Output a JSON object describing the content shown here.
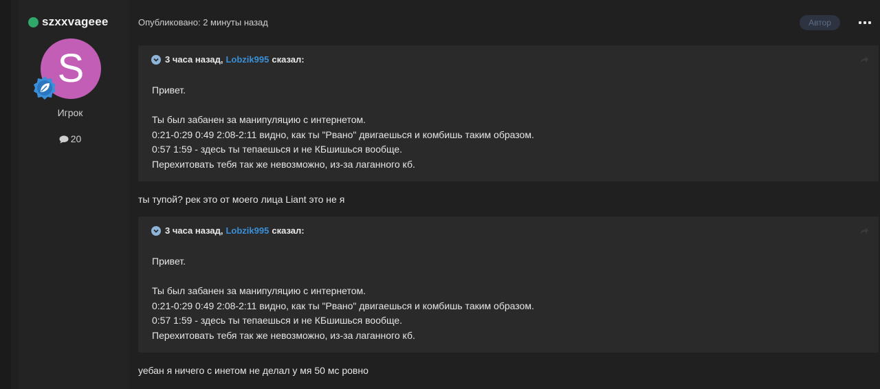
{
  "author": {
    "username": "szxxvageee",
    "avatar_letter": "S",
    "avatar_color": "#c25eb6",
    "online_color": "#2fa86a",
    "role": "Игрок",
    "post_count": "20",
    "rank_icon": "leaf-badge-icon"
  },
  "post": {
    "published": "Опубликовано: 2 минуты назад",
    "author_badge": "Автор"
  },
  "quotes": [
    {
      "time": "3 часа назад,",
      "user": "Lobzik995",
      "said": "сказал:",
      "lines": [
        "Привет.",
        "Ты был забанен за манипуляцию с интернетом.",
        "0:21-0:29 0:49 2:08-2:11 видно, как ты \"Рвано\" двигаешься и комбишь таким образом.",
        "0:57 1:59 - здесь ты тепаешься и не КБшишься вообще.",
        "Перехитовать тебя так же невозможно, из-за лаганного кб."
      ]
    },
    {
      "time": "3 часа назад,",
      "user": "Lobzik995",
      "said": "сказал:",
      "lines": [
        "Привет.",
        "Ты был забанен за манипуляцию с интернетом.",
        "0:21-0:29 0:49 2:08-2:11 видно, как ты \"Рвано\" двигаешься и комбишь таким образом.",
        "0:57 1:59 - здесь ты тепаешься и не КБшишься вообще.",
        "Перехитовать тебя так же невозможно, из-за лаганного кб."
      ]
    }
  ],
  "replies": [
    "ты тупой? рек это от моего лица Liant это не я",
    "уебан я ничего с инетом не делал у мя 50 мс ровно"
  ]
}
